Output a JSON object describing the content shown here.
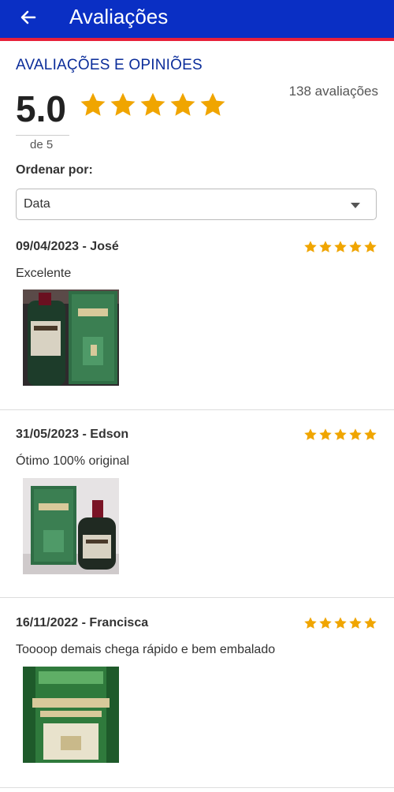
{
  "appbar": {
    "title": "Avaliações"
  },
  "summary": {
    "section_title": "AVALIAÇÕES E OPINIÕES",
    "score": "5.0",
    "out_of": "de 5",
    "count": "138 avaliações",
    "rating": 5
  },
  "sort": {
    "label": "Ordenar por:",
    "selected": "Data"
  },
  "reviews": [
    {
      "header": "09/04/2023 - José",
      "text": "Excelente",
      "rating": 5
    },
    {
      "header": "31/05/2023 - Edson",
      "text": "Ótimo 100% original",
      "rating": 5
    },
    {
      "header": "16/11/2022 - Francisca",
      "text": "Toooop demais chega rápido e bem embalado",
      "rating": 5
    }
  ],
  "colors": {
    "appbar": "#0a2fc4",
    "accent_line": "#e8203a",
    "section_title": "#0b2d9a",
    "star": "#f0a500"
  },
  "icons": {
    "back": "arrow-left-icon",
    "star": "star-icon",
    "dropdown": "caret-down-icon"
  }
}
